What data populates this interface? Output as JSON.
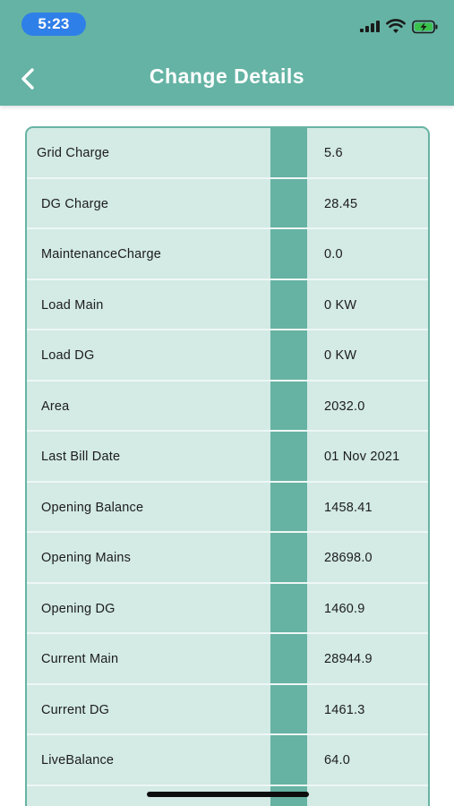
{
  "status_bar": {
    "time": "5:23",
    "signal_icon": "cellular-signal-icon",
    "wifi_icon": "wifi-icon",
    "battery_icon": "battery-charging-icon"
  },
  "nav": {
    "back_icon": "chevron-left-icon",
    "title": "Change Details"
  },
  "colors": {
    "primary": "#65b3a4",
    "card_bg": "#d3eae5",
    "time_pill": "#2f7fe8"
  },
  "details": [
    {
      "label": "Grid Charge",
      "value": "5.6"
    },
    {
      "label": "DG Charge",
      "value": "28.45"
    },
    {
      "label": "MaintenanceCharge",
      "value": "0.0"
    },
    {
      "label": "Load Main",
      "value": "0 KW"
    },
    {
      "label": "Load DG",
      "value": "0 KW"
    },
    {
      "label": "Area",
      "value": "2032.0"
    },
    {
      "label": "Last Bill Date",
      "value": "01 Nov 2021"
    },
    {
      "label": "Opening Balance",
      "value": "1458.41"
    },
    {
      "label": "Opening Mains",
      "value": "28698.0"
    },
    {
      "label": "Opening DG",
      "value": "1460.9"
    },
    {
      "label": "Current Main",
      "value": "28944.9"
    },
    {
      "label": "Current DG",
      "value": "1461.3"
    },
    {
      "label": "LiveBalance",
      "value": "64.0"
    },
    {
      "label": "",
      "value": ""
    }
  ]
}
